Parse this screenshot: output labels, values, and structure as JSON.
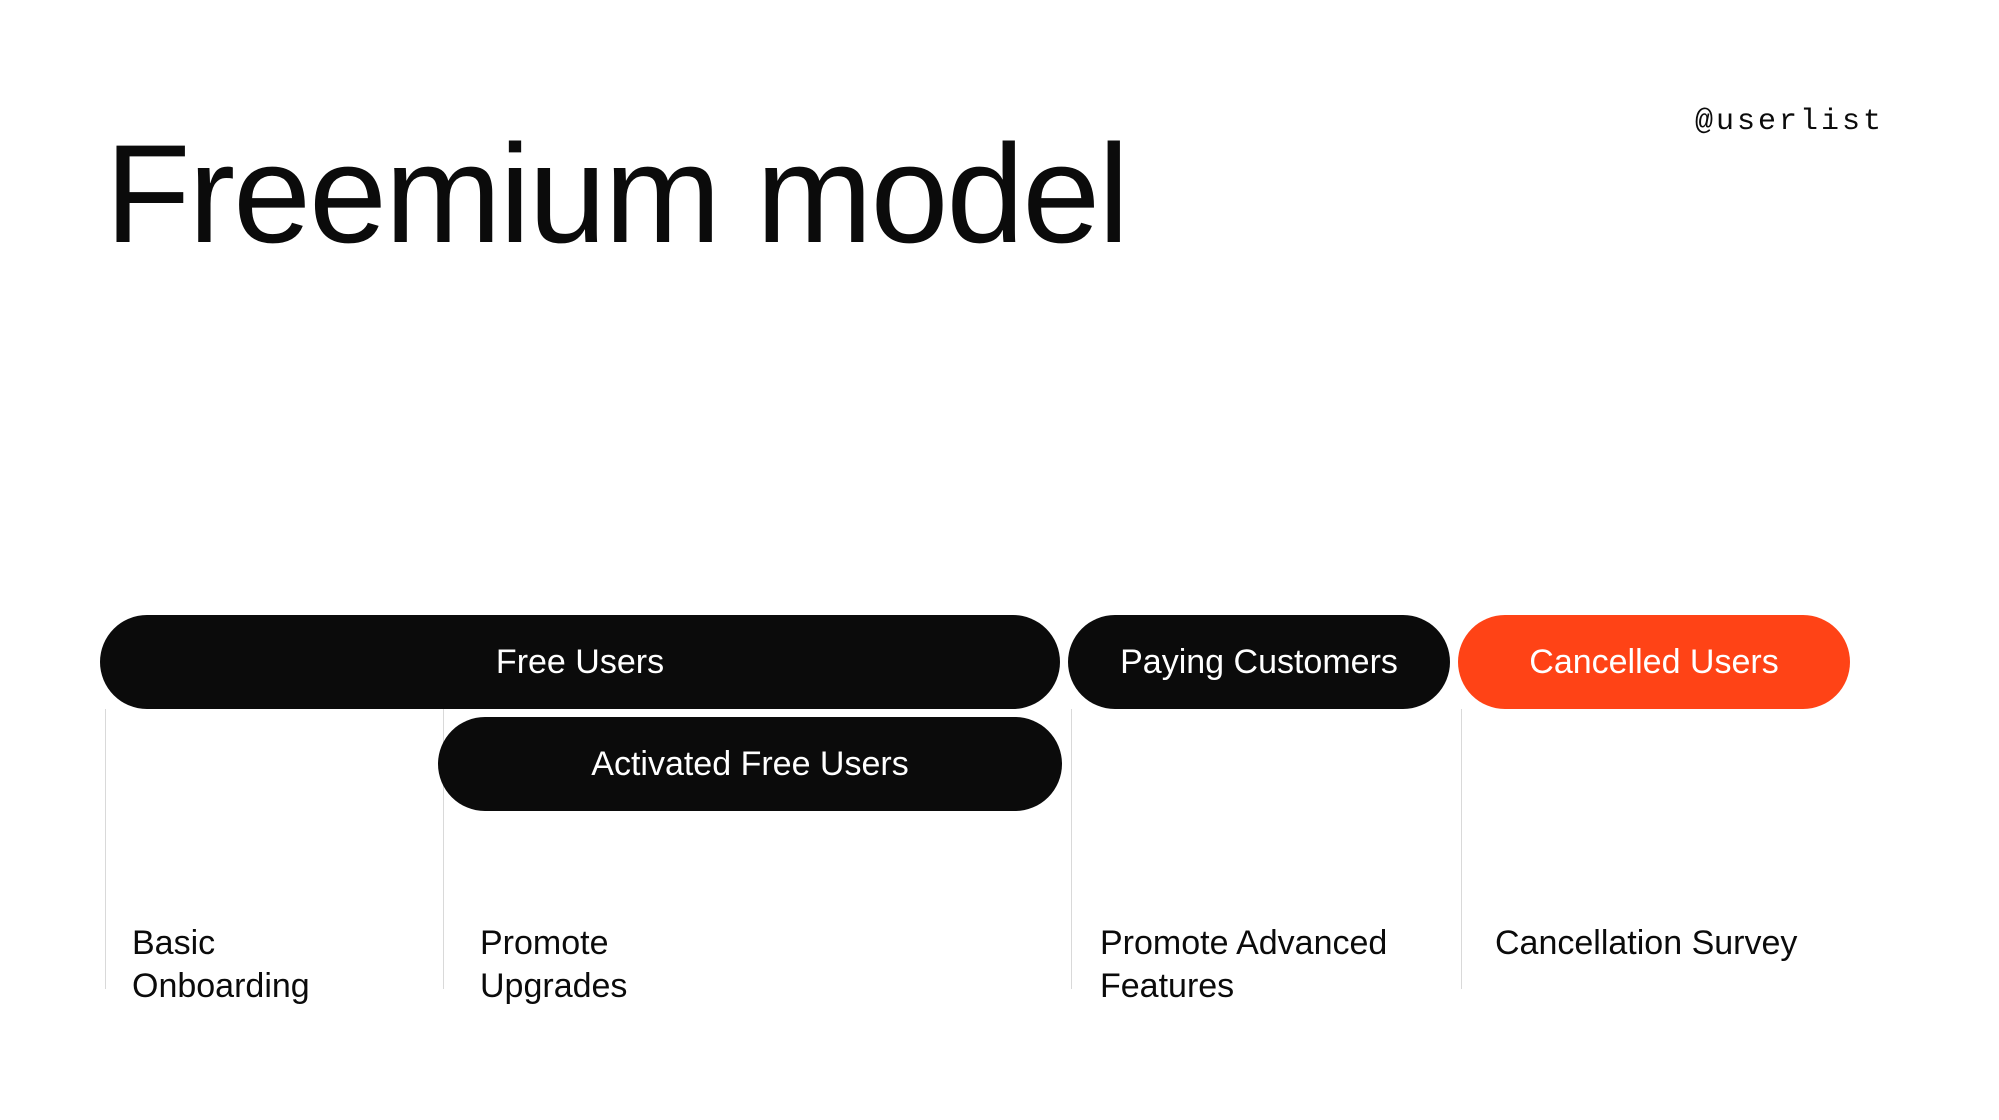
{
  "header": {
    "handle": "@userlist",
    "title": "Freemium model"
  },
  "diagram": {
    "pills": {
      "free": "Free Users",
      "activated": "Activated Free Users",
      "paying": "Paying Customers",
      "cancelled": "Cancelled Users"
    },
    "captions": {
      "c1": "Basic Onboarding",
      "c2": "Promote Upgrades",
      "c3": "Promote Advanced Features",
      "c4": "Cancellation Survey"
    },
    "colors": {
      "pill_black_bg": "#0b0b0b",
      "pill_orange_bg": "#ff4316",
      "pill_text": "#ffffff"
    }
  }
}
